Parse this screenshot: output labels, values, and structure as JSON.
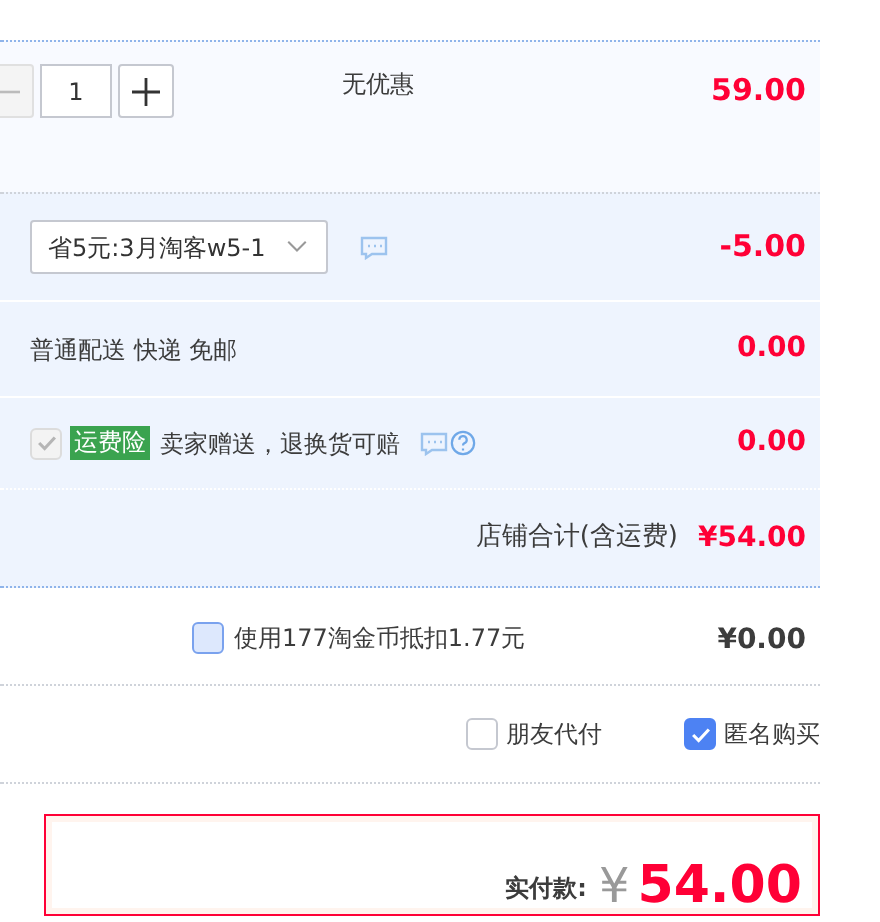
{
  "item": {
    "quantity": "1",
    "promotion": "无优惠",
    "price": "59.00"
  },
  "coupon": {
    "value": "省5元:3月淘客w5-1",
    "amount": "-5.00"
  },
  "shipping": {
    "label": "普通配送 快递 免邮",
    "amount": "0.00"
  },
  "insurance": {
    "checked": true,
    "disabled": true,
    "tag": "运费险",
    "label": "卖家赠送，退换货可赔",
    "amount": "0.00"
  },
  "store_total": {
    "label": "店铺合计(含运费)",
    "amount": "¥54.00"
  },
  "coins": {
    "checked": false,
    "label": "使用177淘金币抵扣1.77元",
    "amount": "¥0.00"
  },
  "options": [
    {
      "label": "朋友代付",
      "checked": false
    },
    {
      "label": "匿名购买",
      "checked": true
    }
  ],
  "payment": {
    "label": "实付款:",
    "currency": "¥",
    "amount": "54.00"
  }
}
